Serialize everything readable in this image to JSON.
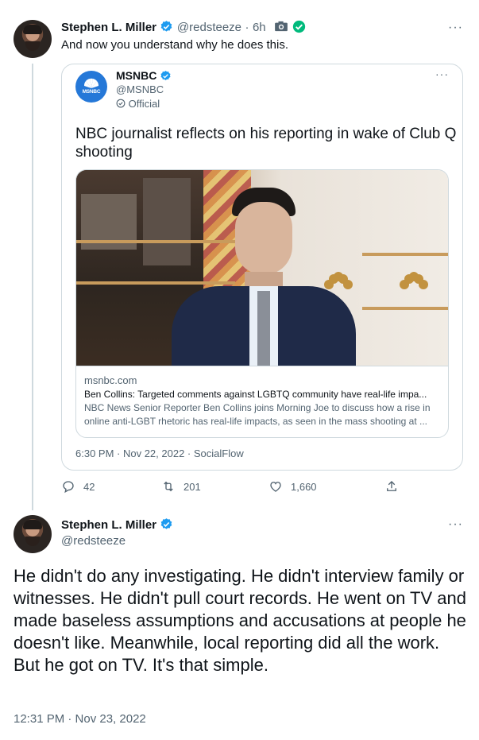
{
  "tweet1": {
    "author_name": "Stephen L. Miller",
    "handle": "@redsteeze",
    "time_ago": "6h",
    "text": "And now you understand why he does this."
  },
  "quote": {
    "author_name": "MSNBC",
    "handle": "@MSNBC",
    "official_label": "Official",
    "logo_text": "MSNBC",
    "title": "NBC journalist reflects on his reporting in wake of Club Q shooting",
    "article": {
      "domain": "msnbc.com",
      "headline": "Ben Collins: Targeted comments against LGBTQ community have real-life impa...",
      "description": "NBC News Senior Reporter Ben Collins joins Morning Joe to discuss how a rise in online anti-LGBT rhetoric has real-life impacts, as seen in the mass shooting at ..."
    },
    "timestamp": "6:30 PM · Nov 22, 2022 · SocialFlow"
  },
  "actions": {
    "replies": "42",
    "retweets": "201",
    "likes": "1,660"
  },
  "tweet2": {
    "author_name": "Stephen L. Miller",
    "handle": "@redsteeze",
    "text": "He didn't do any investigating. He didn't interview family or witnesses. He didn't pull court records. He went on TV and made baseless assumptions and accusations at people he doesn't like. Meanwhile, local reporting did all the work. But he got on TV. It's that simple.",
    "timestamp": "12:31 PM · Nov 23, 2022"
  },
  "colors": {
    "verified": "#1d9bf0",
    "green_check": "#00ba7c",
    "muted_text": "#536471",
    "border": "#cfd9de"
  },
  "icons": [
    "verified-badge-icon",
    "camera-icon",
    "green-check-icon",
    "more-icon",
    "official-badge-icon",
    "reply-icon",
    "retweet-icon",
    "like-icon",
    "share-icon"
  ]
}
